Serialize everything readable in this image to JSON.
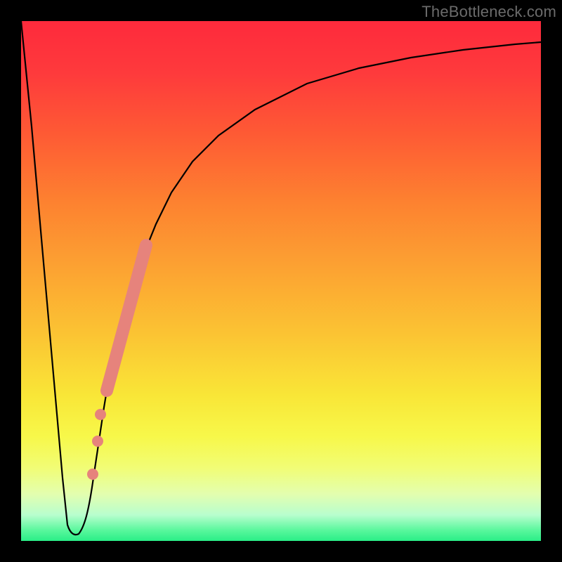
{
  "attribution": "TheBottleneck.com",
  "chart_data": {
    "type": "line",
    "title": "",
    "xlabel": "",
    "ylabel": "",
    "xlim": [
      0,
      100
    ],
    "ylim": [
      0,
      100
    ],
    "grid": false,
    "legend": false,
    "background_gradient": {
      "orientation": "vertical",
      "stops": [
        {
          "pos": 0,
          "color": "#fe2a3c"
        },
        {
          "pos": 50,
          "color": "#fca132"
        },
        {
          "pos": 80,
          "color": "#f7f84a"
        },
        {
          "pos": 100,
          "color": "#2aee87"
        }
      ]
    },
    "series": [
      {
        "name": "bottleneck-curve",
        "color": "#000000",
        "stroke_width": 2,
        "x": [
          0,
          2,
          4,
          6,
          8,
          9,
          10,
          11,
          12,
          13,
          14,
          16,
          18,
          20,
          22,
          24,
          26,
          29,
          33,
          38,
          45,
          55,
          65,
          75,
          85,
          95,
          100
        ],
        "y": [
          100,
          80,
          58,
          35,
          12,
          3,
          1,
          1,
          3,
          8,
          14,
          25,
          35,
          43,
          50,
          56,
          61,
          67,
          73,
          78,
          83,
          88,
          91,
          93,
          94.5,
          95.5,
          96
        ]
      },
      {
        "name": "highlight-segment",
        "color": "#e6837c",
        "stroke_width": 12,
        "x": [
          16.5,
          24.0
        ],
        "y": [
          29,
          57
        ]
      }
    ],
    "markers": [
      {
        "name": "highlight-dot-1",
        "x": 14.7,
        "y": 19,
        "r": 6,
        "color": "#e6837c"
      },
      {
        "name": "highlight-dot-2",
        "x": 15.5,
        "y": 24,
        "r": 6,
        "color": "#e6837c"
      },
      {
        "name": "highlight-dot-3",
        "x": 13.8,
        "y": 13,
        "r": 6,
        "color": "#e6837c"
      }
    ]
  }
}
